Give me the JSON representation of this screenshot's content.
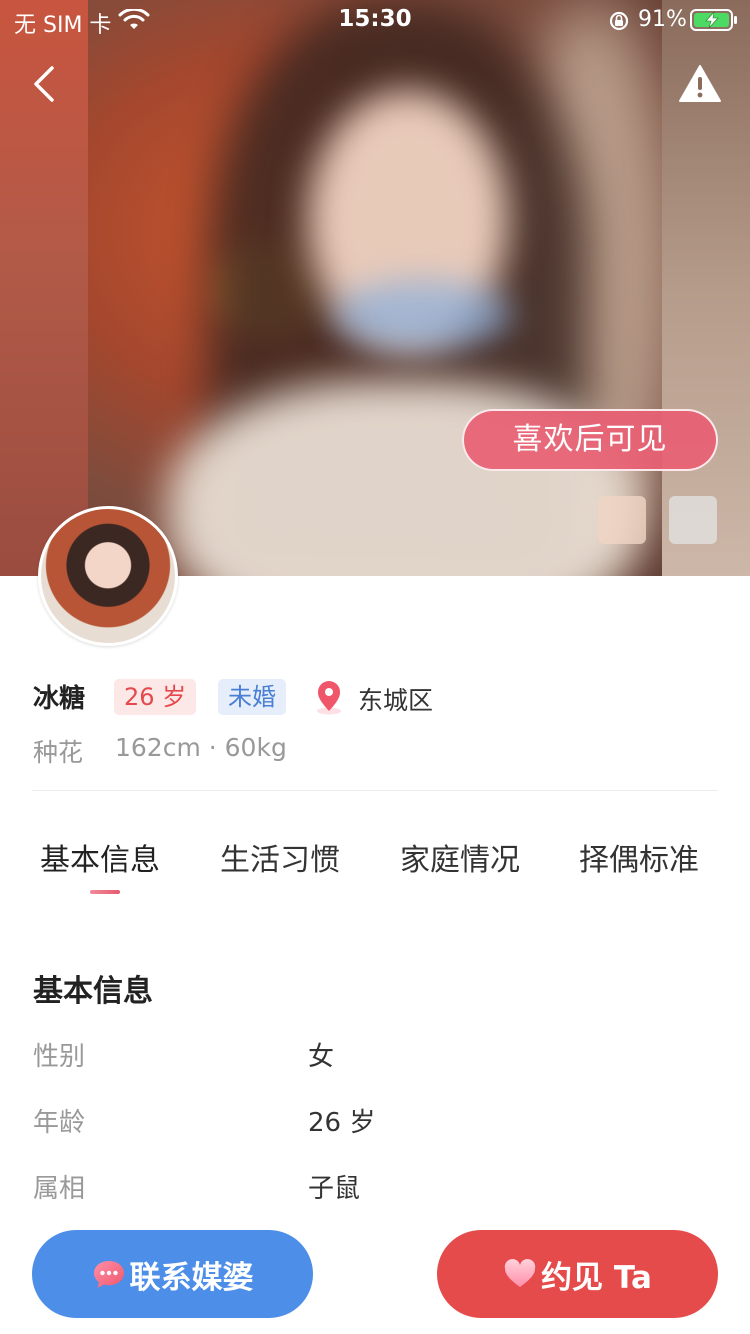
{
  "status_bar": {
    "carrier": "无 SIM 卡",
    "time": "15:30",
    "battery": "91%"
  },
  "hero": {
    "like_to_view": "喜欢后可见"
  },
  "profile": {
    "name": "冰糖",
    "age": "26 岁",
    "marital_status": "未婚",
    "location": "东城区",
    "occupation": "种花",
    "stats": "162cm · 60kg"
  },
  "tabs": [
    {
      "label": "基本信息",
      "active": true
    },
    {
      "label": "生活习惯",
      "active": false
    },
    {
      "label": "家庭情况",
      "active": false
    },
    {
      "label": "择偶标准",
      "active": false
    }
  ],
  "basic_info": {
    "title": "基本信息",
    "rows": [
      {
        "label": "性别",
        "value": "女"
      },
      {
        "label": "年龄",
        "value": "26 岁"
      },
      {
        "label": "属相",
        "value": "子鼠"
      }
    ]
  },
  "actions": {
    "contact_matchmaker": "联系媒婆",
    "meet": "约见 Ta"
  },
  "colors": {
    "accent_pink": "#e85a6d",
    "contact_blue": "#4d8ee8",
    "meet_red": "#e54b4b"
  }
}
